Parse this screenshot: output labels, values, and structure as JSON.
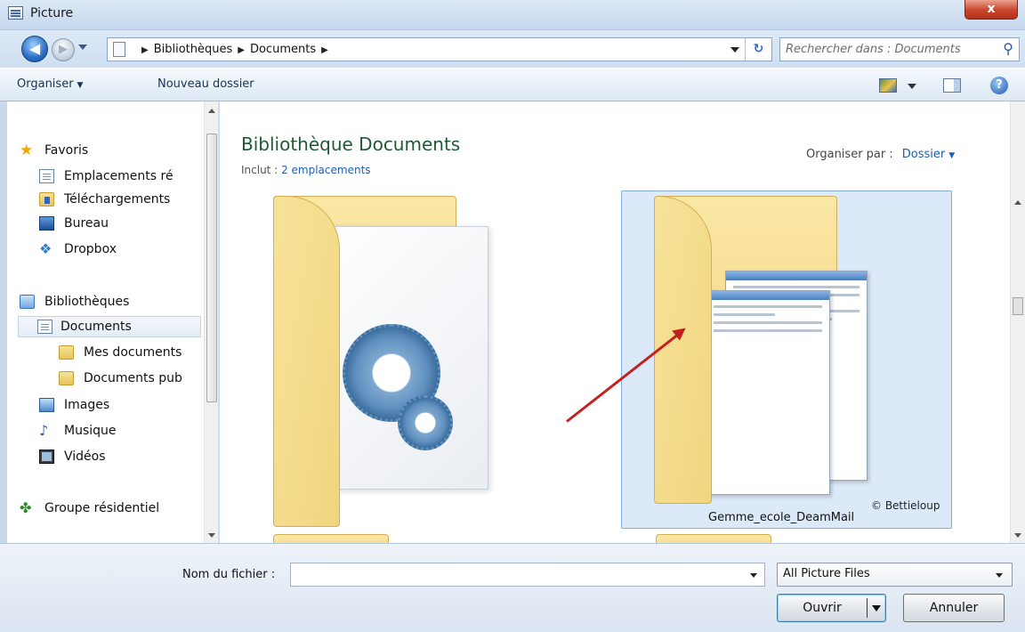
{
  "window": {
    "title": "Picture",
    "close_label": "x"
  },
  "address": {
    "crumbs": [
      "Bibliothèques",
      "Documents"
    ],
    "search_placeholder": "Rechercher dans : Documents"
  },
  "toolbar": {
    "organize_label": "Organiser",
    "new_folder_label": "Nouveau dossier"
  },
  "sidebar": {
    "favorites": [
      {
        "label": "Favoris",
        "icon": "star-icon"
      },
      {
        "label": "Emplacements ré",
        "icon": "recent-places-icon"
      },
      {
        "label": "Téléchargements",
        "icon": "downloads-folder-icon"
      },
      {
        "label": "Bureau",
        "icon": "desktop-icon"
      },
      {
        "label": "Dropbox",
        "icon": "dropbox-icon"
      }
    ],
    "libraries": [
      {
        "label": "Bibliothèques",
        "icon": "libraries-icon"
      },
      {
        "label": "Documents",
        "icon": "documents-icon",
        "selected": true
      },
      {
        "label": "Mes documents",
        "icon": "folder-icon"
      },
      {
        "label": "Documents pub",
        "icon": "folder-icon"
      },
      {
        "label": "Images",
        "icon": "pictures-icon"
      },
      {
        "label": "Musique",
        "icon": "music-icon"
      },
      {
        "label": "Vidéos",
        "icon": "videos-icon"
      }
    ],
    "homegroup": {
      "label": "Groupe résidentiel",
      "icon": "homegroup-icon"
    }
  },
  "content": {
    "title": "Bibliothèque Documents",
    "inclut_label": "Inclut :",
    "inclut_link": "2 emplacements",
    "arrange_label": "Organiser par :",
    "arrange_value": "Dossier",
    "items": [
      {
        "label": "",
        "icon": "settings-folder-icon"
      },
      {
        "label": "Gemme_ecole_DeamMail",
        "icon": "screenshot-folder-icon",
        "selected": true
      }
    ],
    "watermark": "© Bettieloup"
  },
  "footer": {
    "filename_label": "Nom du fichier :",
    "filename_value": "",
    "filter_value": "All Picture Files",
    "open_label": "Ouvrir",
    "cancel_label": "Annuler"
  },
  "colors": {
    "selection": "#dce9f8",
    "library_title": "#1e5a33",
    "link": "#1c5fb4",
    "annotation_arrow": "#c42020"
  }
}
